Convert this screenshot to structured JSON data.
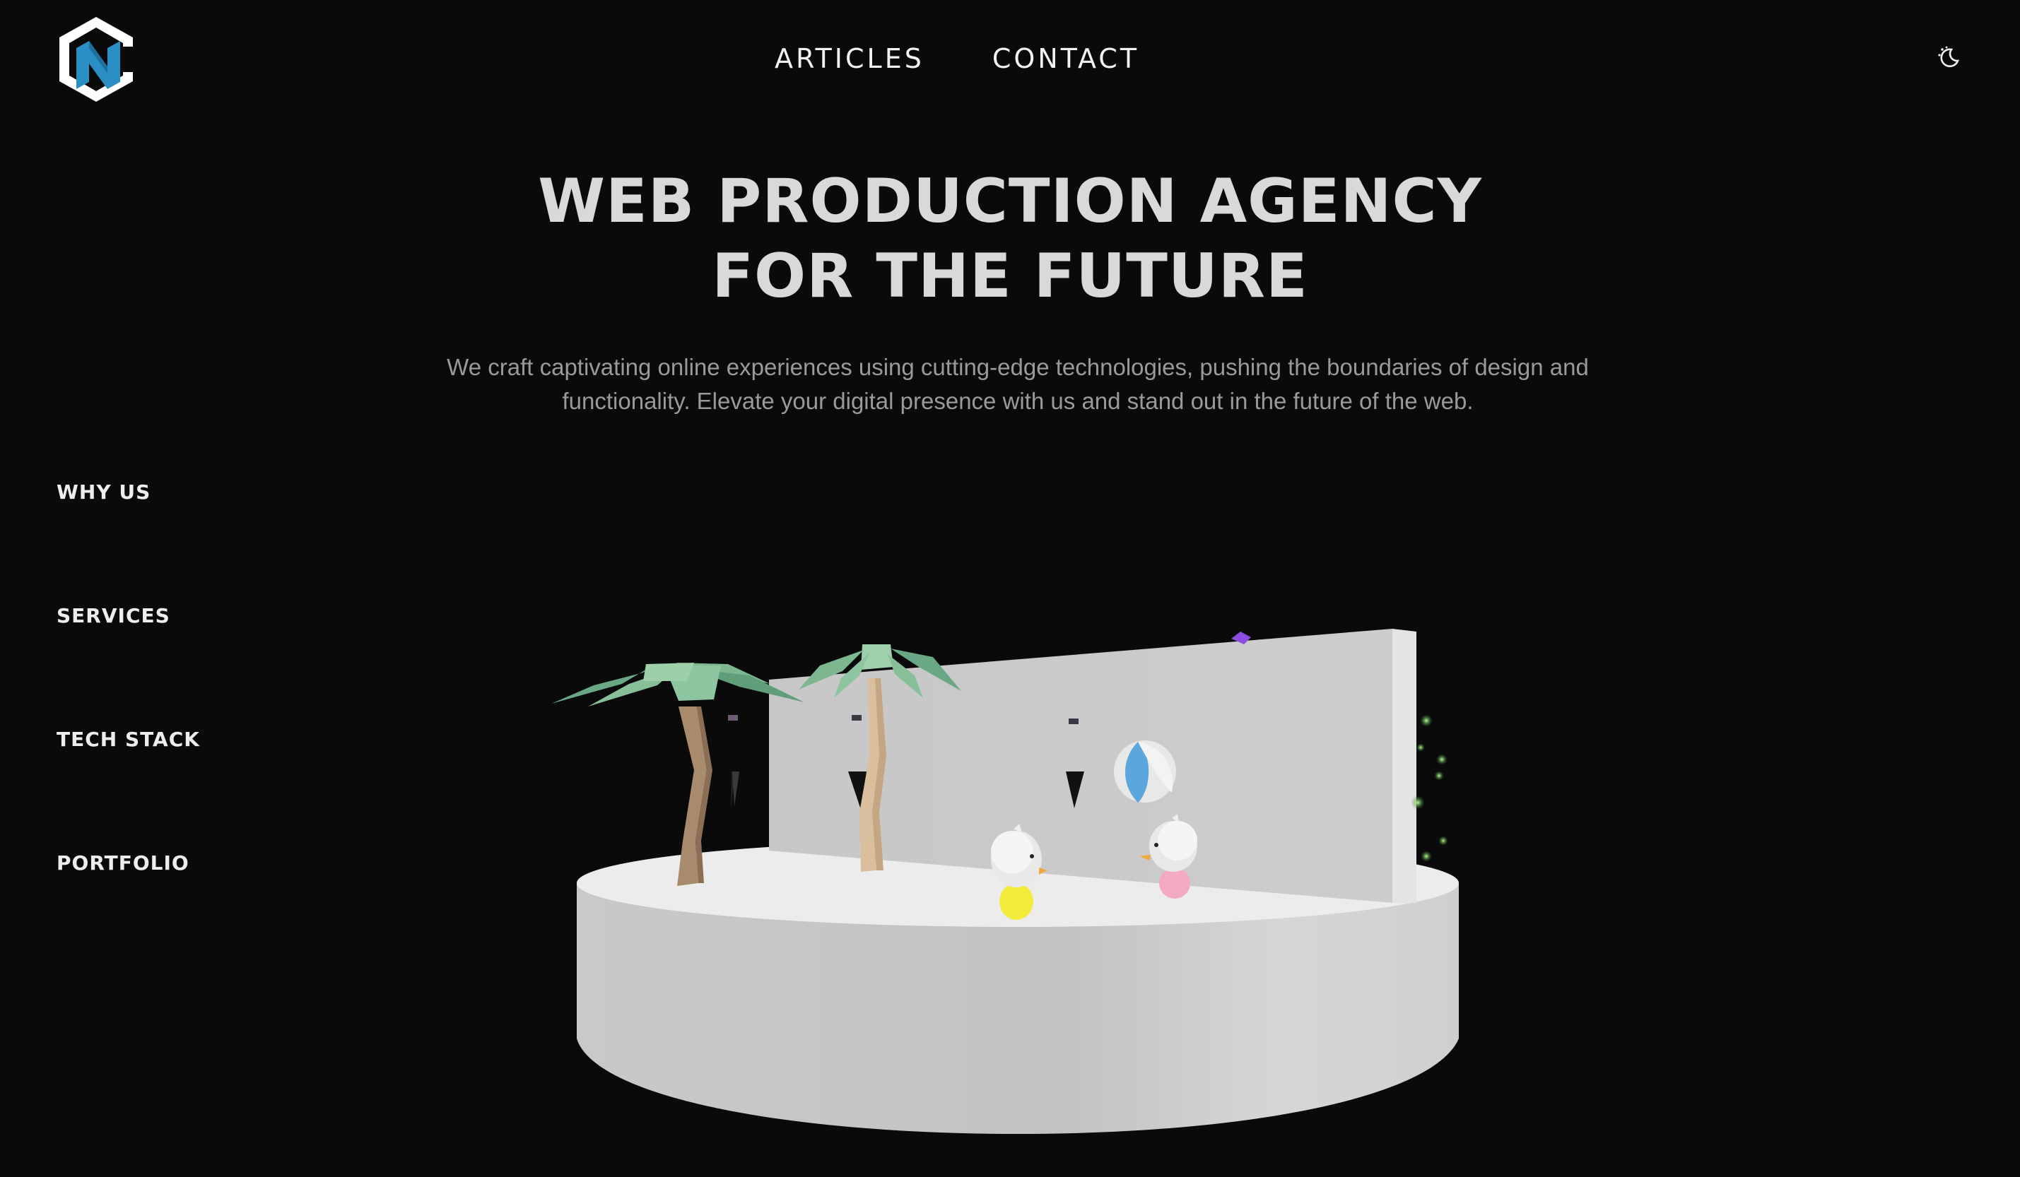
{
  "header": {
    "logo_icon": "hexagon-n-logo",
    "nav": [
      "ARTICLES",
      "CONTACT"
    ],
    "theme_toggle_icon": "moon-sun-icon"
  },
  "hero": {
    "title_line1": "WEB PRODUCTION AGENCY",
    "title_line2": "FOR THE FUTURE",
    "subtitle_line1": "We craft captivating online experiences using cutting-edge technologies, pushing the boundaries of design and",
    "subtitle_line2": "functionality. Elevate your digital presence with us and stand out in the future of the web."
  },
  "side_nav": [
    "WHY US",
    "SERVICES",
    "TECH STACK",
    "PORTFOLIO"
  ],
  "scene": {
    "description_icons": [
      "palm-tree-icon",
      "beach-ball-icon",
      "duck-figure-icon"
    ]
  },
  "colors": {
    "background": "#0a0a0b",
    "logo_blue": "#2b8fc4",
    "title": "#d9d9d9",
    "subtitle": "#9a9a9e"
  }
}
